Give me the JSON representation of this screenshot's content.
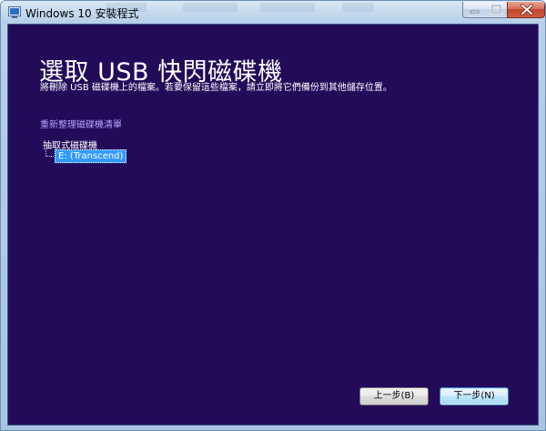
{
  "window": {
    "title": "Windows 10 安裝程式"
  },
  "page": {
    "heading": "選取 USB 快閃磁碟機",
    "subtext": "將刪除 USB 磁碟機上的檔案。若要保留這些檔案，請立即將它們備份到其他儲存位置。",
    "refresh_link": "重新整理磁碟機清單"
  },
  "tree": {
    "root_label": "抽取式磁碟機",
    "items": [
      {
        "label": "E: (Transcend)",
        "selected": true
      }
    ]
  },
  "buttons": {
    "back": "上一步(B)",
    "next": "下一步(N)"
  },
  "icons": {
    "app": "setup-app-icon",
    "minimize": "minimize-icon",
    "maximize": "maximize-icon",
    "close": "close-icon"
  },
  "colors": {
    "content_background": "#230b5a",
    "link": "#b6a3ff",
    "selection": "#3399ff"
  }
}
